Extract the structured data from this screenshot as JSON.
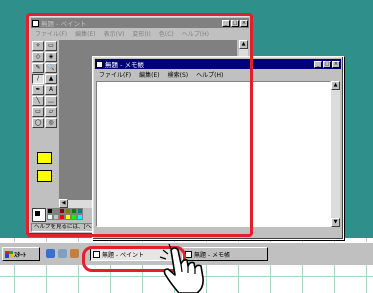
{
  "paint_window": {
    "title": "無題 - ペイント",
    "menu": [
      "ファイル(F)",
      "編集(E)",
      "表示(V)",
      "変形(I)",
      "色(C)",
      "ヘルプ(H)"
    ],
    "tools": [
      "✧",
      "▭",
      "◇",
      "◈",
      "✎",
      "🔍",
      "∕",
      "▲",
      "✒",
      "A",
      "╲",
      "﹏",
      "▭",
      "▱",
      "◯",
      "◎"
    ],
    "status": "ヘルプを見るには、[ヘルプ]"
  },
  "notepad_window": {
    "title": "無題 - メモ帳",
    "menu": [
      "ファイル(F)",
      "編集(E)",
      "検索(S)",
      "ヘルプ(H)"
    ],
    "text": ""
  },
  "taskbar": {
    "start_label": "ｽﾀｰﾄ",
    "items": [
      "無題 - ペイント",
      "無題 - メモ帳"
    ]
  },
  "colors": {
    "desktop": "#2f8f8b",
    "highlight": "#e0202a",
    "active_title": "#00007b"
  },
  "palette_colors": [
    "#000000",
    "#808080",
    "#800000",
    "#808000",
    "#008000",
    "#008080",
    "#ffffff",
    "#c0c0c0",
    "#ff0000",
    "#ffff00",
    "#00ff00",
    "#00ffff"
  ]
}
